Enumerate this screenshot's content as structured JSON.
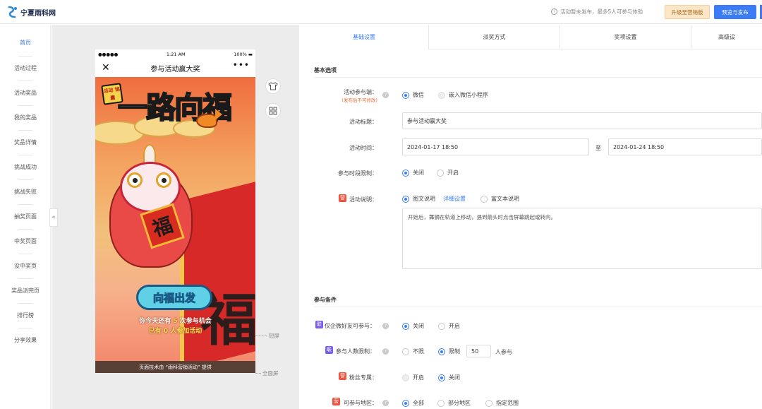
{
  "topbar": {
    "logo_text": "宁夏雨科网",
    "notice": "活动暂未发布，最多5人可参与体验",
    "upgrade_label": "升级至营销版",
    "publish_label": "预览与发布"
  },
  "sidebar": {
    "items": [
      {
        "label": "首页",
        "active": true
      },
      {
        "label": "活动过程"
      },
      {
        "label": "活动奖品"
      },
      {
        "label": "我的奖品"
      },
      {
        "label": "奖品详情"
      },
      {
        "label": "挑战成功"
      },
      {
        "label": "挑战失败"
      },
      {
        "label": "抽奖页面"
      },
      {
        "label": "中奖页面"
      },
      {
        "label": "没中奖页"
      },
      {
        "label": "奖品派完页"
      },
      {
        "label": "排行榜"
      },
      {
        "label": "分享效果"
      }
    ],
    "collapse_glyph": "«"
  },
  "phone": {
    "status": {
      "signal": "●●●●●",
      "time": "1:21 AM",
      "battery": "100% ▬"
    },
    "nav_title": "参与活动赢大奖",
    "close_glyph": "✕",
    "more_glyph": "•••",
    "poster": {
      "stamp": "活动\n锦囊",
      "title": "一路向福",
      "fu_small": "福",
      "fu_big": "福",
      "cta": "向福出发",
      "chance_prefix": "你今天还有",
      "chance_count": "5",
      "chance_suffix": "次参与机会",
      "participants": "已有 0 人参加活动",
      "complain": "投诉"
    },
    "footer": "页面技术由 “雨科营销活动” 提供"
  },
  "canvas_markers": {
    "short_screen": "短屏",
    "full_screen": "全面屏"
  },
  "tabs": [
    {
      "label": "基础设置",
      "active": true
    },
    {
      "label": "派奖方式"
    },
    {
      "label": "奖项设置"
    },
    {
      "label": "高级设"
    }
  ],
  "form": {
    "basic_section": "基本选项",
    "entry_label": "活动参与端：",
    "entry_sub": "(发布后不可修改)",
    "entry_options": [
      "微信",
      "嵌入微信小程序"
    ],
    "title_label": "活动标题：",
    "title_value": "参与活动赢大奖",
    "time_label": "活动时间：",
    "time_start": "2024-01-17 18:50",
    "time_to": "至",
    "time_end": "2024-01-24 18:50",
    "period_label": "参与时段限制：",
    "period_options": [
      "关闭",
      "开启"
    ],
    "desc_label": "活动说明：",
    "desc_options": [
      "图文说明",
      "富文本说明"
    ],
    "desc_link": "详细设置",
    "desc_text": "开始后，舞狮在轨道上移动，遇到箭头时点击屏幕跳起或转向。",
    "cond_section": "参与条件",
    "friend_label": "仅企微好友可参与：",
    "friend_options": [
      "关闭",
      "开启"
    ],
    "count_label": "参与人数限制：",
    "count_options": [
      "不限",
      "限制"
    ],
    "count_value": "50",
    "count_unit": "人参与",
    "fans_label": "粉丝专属：",
    "fans_options": [
      "开启",
      "关闭"
    ],
    "region_label": "可参与地区：",
    "region_options": [
      "全部",
      "部分地区",
      "指定范围"
    ],
    "badge_ying": "营",
    "badge_lian": "联",
    "help_glyph": "?"
  },
  "colors": {
    "primary": "#3b7cf5",
    "upgrade_bg": "#fbe6c8",
    "badge_red": "#f0533f",
    "badge_purple": "#7a5cf0"
  }
}
